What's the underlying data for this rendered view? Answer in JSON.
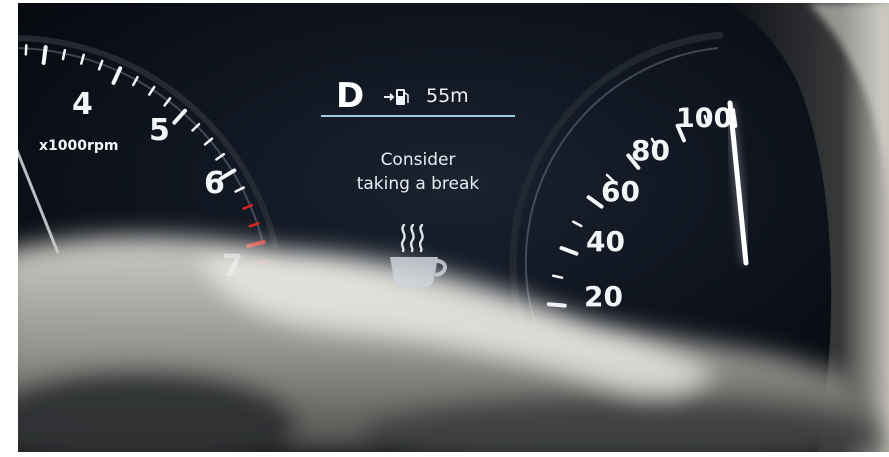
{
  "tachometer": {
    "tick_labels": [
      "4",
      "5",
      "6",
      "7"
    ],
    "unit_label": "x1000rpm"
  },
  "info_display": {
    "gear": "D",
    "fuel_icon": "fuel-pump-icon",
    "range": "55m",
    "message_line1": "Consider",
    "message_line2": "taking a break",
    "icon": "coffee-cup-icon"
  },
  "speedometer": {
    "tick_labels": [
      "20",
      "40",
      "60",
      "80",
      "100"
    ]
  },
  "colors": {
    "background": "#0c1018",
    "label_text": "#f2f4f6",
    "redline": "#d9221c",
    "divider": "#9fc8e6",
    "needle": "#ffffff"
  }
}
